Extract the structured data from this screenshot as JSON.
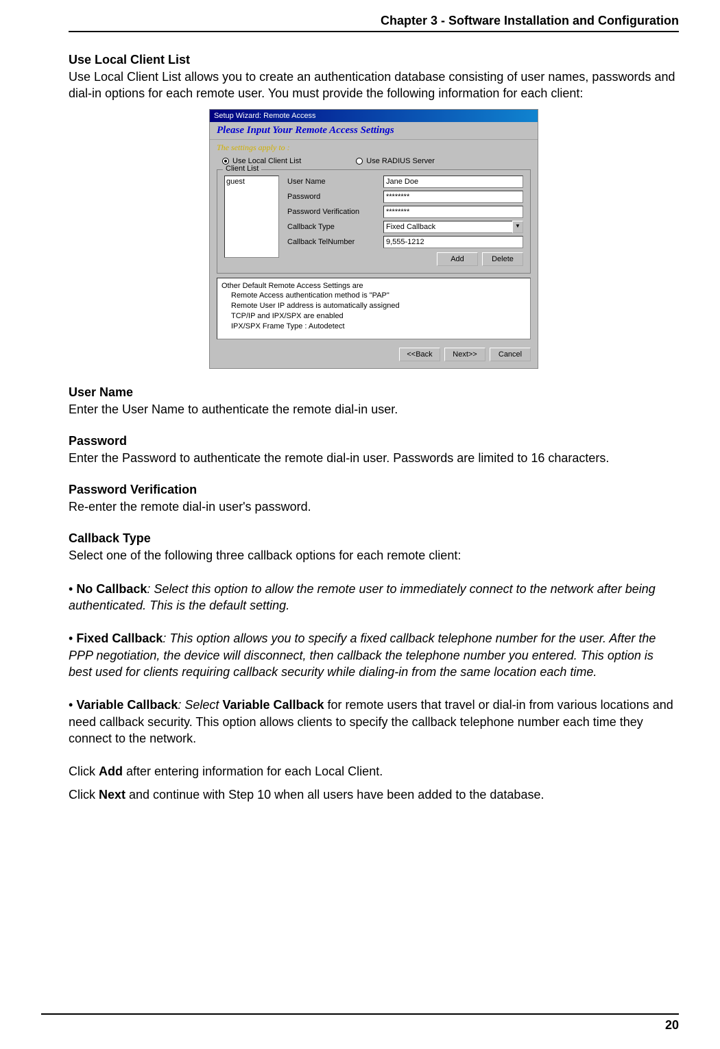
{
  "header": "Chapter 3 - Software Installation and Configuration",
  "page_number": "20",
  "sec1": {
    "title": "Use Local Client List",
    "body": "Use Local Client List allows you to create an authentication database consisting of user names, passwords and dial-in options for each remote user.  You must provide the following information for each client:"
  },
  "wizard": {
    "title": "Setup Wizard: Remote Access",
    "heading": "Please Input Your Remote Access Settings",
    "subheading": "The settings apply to :",
    "radio_local": "Use Local Client List",
    "radio_radius": "Use RADIUS Server",
    "legend": "Client List",
    "list_item": "guest",
    "labels": {
      "user": "User Name",
      "pass": "Password",
      "verify": "Password Verification",
      "cbtype": "Callback Type",
      "cbtel": "Callback TelNumber"
    },
    "values": {
      "user": "Jane Doe",
      "pass": "********",
      "verify": "********",
      "cbtype": "Fixed Callback",
      "cbtel": "9,555-1212"
    },
    "btn_add": "Add",
    "btn_delete": "Delete",
    "info_title": "Other Default Remote Access Settings are",
    "info_l1": "Remote Access authentication method is \"PAP\"",
    "info_l2": "Remote User IP address is automatically assigned",
    "info_l3": "TCP/IP and IPX/SPX are enabled",
    "info_l4": "IPX/SPX Frame Type : Autodetect",
    "btn_back": "<<Back",
    "btn_next": "Next>>",
    "btn_cancel": "Cancel"
  },
  "user_name": {
    "title": "User Name",
    "body": "Enter the User Name to authenticate the remote dial-in user."
  },
  "password": {
    "title": "Password",
    "body": "Enter the Password to authenticate the remote dial-in user.  Passwords are limited to 16 characters."
  },
  "verify": {
    "title": "Password Verification",
    "body": "Re-enter the remote dial-in user's password."
  },
  "cbtype": {
    "title": "Callback Type",
    "body": "Select one of the following three callback options for each remote client:"
  },
  "no_cb": {
    "bullet": "• ",
    "label": "No Callback",
    "rest": ": Select this option to allow the remote user to immediately connect to the network after being authenticated.  This is the default setting."
  },
  "fixed_cb": {
    "bullet": "• ",
    "label": "Fixed Callback",
    "rest": ": This option allows you to specify a fixed callback telephone number for the user.  After the PPP negotiation, the device will disconnect, then callback the telephone number you entered.  This option is best used for clients requiring callback security while dialing-in from the same location each time."
  },
  "var_cb": {
    "bullet": "• ",
    "label": "Variable Callback",
    "mid1": ": Select ",
    "bold2": "Variable Callback",
    "rest": " for remote users that travel or dial-in from various locations and need callback security.  This option allows clients to specify the callback telephone number each time they connect to the network."
  },
  "click_add": {
    "pre": "Click ",
    "bold": "Add",
    "post": " after entering information for each Local Client."
  },
  "click_next": {
    "pre": "Click ",
    "bold": "Next",
    "post": " and continue with Step 10 when all users have been added to the database."
  }
}
